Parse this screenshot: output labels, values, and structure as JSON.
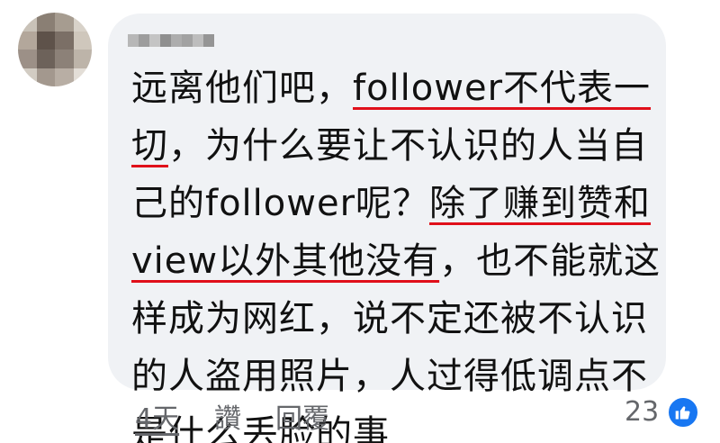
{
  "comment": {
    "author_name_redacted": true,
    "lines": [
      [
        {
          "t": "远离他们吧，"
        },
        {
          "t": "follower不代表一",
          "u": true
        }
      ],
      [
        {
          "t": "切",
          "u": true
        },
        {
          "t": "，为什么要让不认识的人当自"
        }
      ],
      [
        {
          "t": "己的follower呢？"
        },
        {
          "t": "除了赚到赞和",
          "u": true
        }
      ],
      [
        {
          "t": "view以外其他没有",
          "u": true
        },
        {
          "t": "，也不能就这"
        }
      ],
      [
        {
          "t": "样成为网红，说不定还被不认识"
        }
      ],
      [
        {
          "t": "的人盗用照片，人过得低调点不"
        }
      ],
      [
        {
          "t": "是什么丢脸的事"
        }
      ]
    ]
  },
  "footer": {
    "time_label": "4天",
    "like_label": "讚",
    "reply_label": "回覆",
    "reaction_count": "23"
  },
  "icons": {
    "reaction": "thumbs-up-icon"
  },
  "colors": {
    "bubble": "#f0f2f5",
    "underline": "#e0101a",
    "like_badge": "#1877f2",
    "meta_text": "#65676b"
  }
}
